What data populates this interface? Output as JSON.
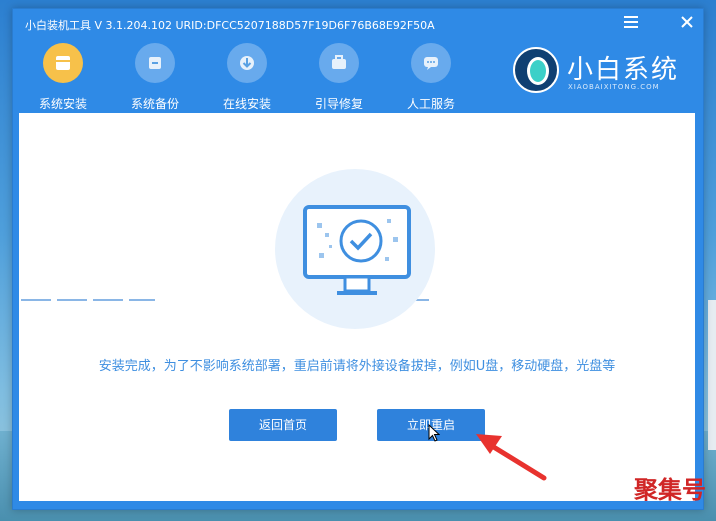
{
  "window": {
    "title": "小白装机工具 V 3.1.204.102 URID:DFCC5207188D57F19D6F76B68E92F50A",
    "menu_icon": "menu-icon",
    "close_icon": "close-icon"
  },
  "nav": {
    "items": [
      {
        "label": "系统安装",
        "icon": "install-icon",
        "active": true
      },
      {
        "label": "系统备份",
        "icon": "backup-icon",
        "active": false
      },
      {
        "label": "在线安装",
        "icon": "download-icon",
        "active": false
      },
      {
        "label": "引导修复",
        "icon": "repair-icon",
        "active": false
      },
      {
        "label": "人工服务",
        "icon": "chat-icon",
        "active": false
      }
    ]
  },
  "logo": {
    "title": "小白系统",
    "subtitle": "XIAOBAIXITONG.COM"
  },
  "content": {
    "message": "安装完成，为了不影响系统部署，重启前请将外接设备拔掉，例如U盘，移动硬盘，光盘等",
    "home_button": "返回首页",
    "restart_button": "立即重启"
  },
  "watermark": "聚集号",
  "colors": {
    "accent": "#2f8ae6",
    "active_nav": "#f7c14a",
    "message": "#3f8fe0",
    "annotation_arrow": "#e8322e"
  }
}
